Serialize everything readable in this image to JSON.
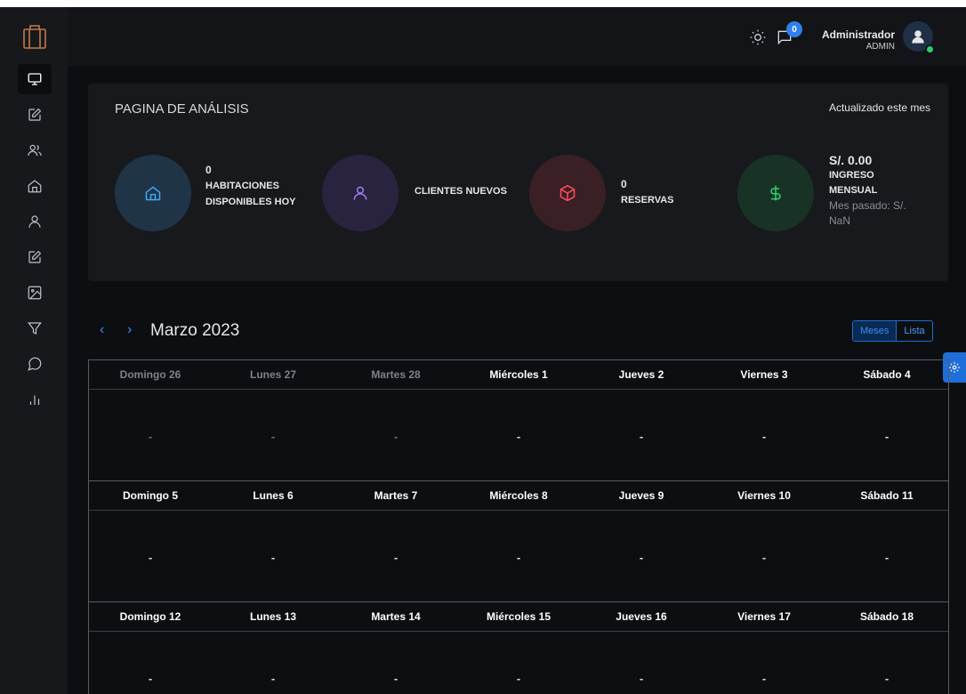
{
  "header": {
    "user_name": "Administrador",
    "user_role": "ADMIN",
    "notifications_count": "0"
  },
  "sidebar": {
    "items": [
      {
        "icon": "monitor-icon",
        "active": true
      },
      {
        "icon": "edit-icon"
      },
      {
        "icon": "users-icon"
      },
      {
        "icon": "home-icon"
      },
      {
        "icon": "user-icon"
      },
      {
        "icon": "edit-icon"
      },
      {
        "icon": "image-icon"
      },
      {
        "icon": "filter-icon"
      },
      {
        "icon": "chat-icon"
      },
      {
        "icon": "bar-chart-icon"
      }
    ]
  },
  "analysis": {
    "title": "PAGINA DE ANÁLISIS",
    "updated": "Actualizado este mes",
    "stats": {
      "rooms": {
        "value": "0",
        "label_line1": "HABITACIONES",
        "label_line2": "DISPONIBLES HOY",
        "color": "#1f3447",
        "icon_color": "#3fa9f5"
      },
      "clients": {
        "label": "CLIENTES NUEVOS",
        "color": "#2a2340",
        "icon_color": "#a07cf0"
      },
      "bookings": {
        "value": "0",
        "label": "RESERVAS",
        "color": "#3a1f24",
        "icon_color": "#ff4d5e"
      },
      "income": {
        "value": "S/. 0.00",
        "label_line1": "INGRESO",
        "label_line2": "MENSUAL",
        "note_line1": "Mes pasado: S/.",
        "note_line2": "NaN",
        "color": "#183326",
        "icon_color": "#2ed573"
      }
    }
  },
  "calendar": {
    "prev_label": "‹",
    "next_label": "›",
    "title": "Marzo 2023",
    "view_months": "Meses",
    "view_list": "Lista",
    "empty": "-",
    "weeks": [
      [
        {
          "label": "Domingo 26",
          "muted": true
        },
        {
          "label": "Lunes 27",
          "muted": true
        },
        {
          "label": "Martes 28",
          "muted": true
        },
        {
          "label": "Miércoles 1"
        },
        {
          "label": "Jueves 2"
        },
        {
          "label": "Viernes 3"
        },
        {
          "label": "Sábado 4"
        }
      ],
      [
        {
          "label": "Domingo 5"
        },
        {
          "label": "Lunes 6"
        },
        {
          "label": "Martes 7"
        },
        {
          "label": "Miércoles 8"
        },
        {
          "label": "Jueves 9"
        },
        {
          "label": "Viernes 10"
        },
        {
          "label": "Sábado 11"
        }
      ],
      [
        {
          "label": "Domingo 12"
        },
        {
          "label": "Lunes 13"
        },
        {
          "label": "Martes 14"
        },
        {
          "label": "Miércoles 15"
        },
        {
          "label": "Jueves 16"
        },
        {
          "label": "Viernes 17"
        },
        {
          "label": "Sábado 18"
        }
      ]
    ]
  },
  "colors": {
    "accent": "#2f80ed",
    "online": "#2ecc71"
  }
}
